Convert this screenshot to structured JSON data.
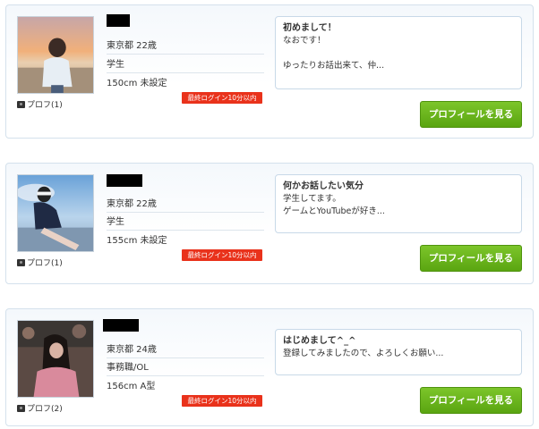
{
  "cards": [
    {
      "location_age": "東京都 22歳",
      "occupation": "学生",
      "height_blood": "150cm 未設定",
      "photo_label": "プロフ(1)",
      "login_badge": "最終ログイン10分以内",
      "message_title": "初めまして！",
      "message_lines": [
        "なおです！",
        "",
        "ゆったりお話出来て、仲..."
      ],
      "button_label": "プロフィールを見る"
    },
    {
      "location_age": "東京都 22歳",
      "occupation": "学生",
      "height_blood": "155cm 未設定",
      "photo_label": "プロフ(1)",
      "login_badge": "最終ログイン10分以内",
      "message_title": "何かお話したい気分",
      "message_lines": [
        "学生してます。",
        "ゲームとYouTubeが好き..."
      ],
      "button_label": "プロフィールを見る"
    },
    {
      "location_age": "東京都 24歳",
      "occupation": "事務職/OL",
      "height_blood": "156cm A型",
      "photo_label": "プロフ(2)",
      "login_badge": "最終ログイン10分以内",
      "message_title": "はじめまして^_^",
      "message_lines": [
        "登録してみましたので、よろしくお願い..."
      ],
      "button_label": "プロフィールを見る"
    }
  ]
}
